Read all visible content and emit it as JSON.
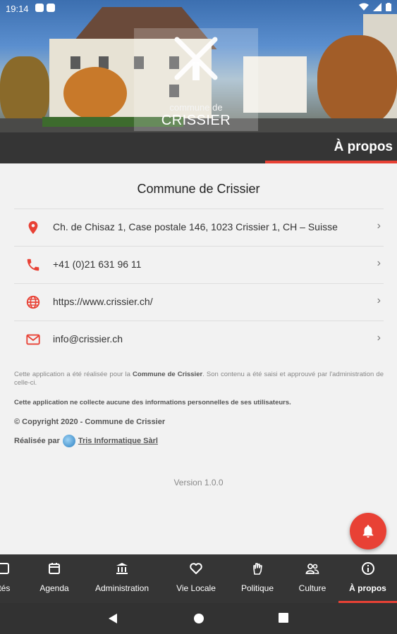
{
  "status_bar": {
    "time": "19:14",
    "battery": "◢"
  },
  "hero": {
    "logo_subtitle": "commune de",
    "logo_title": "CRISSIER"
  },
  "header": {
    "title": "À propos"
  },
  "content": {
    "heading": "Commune de Crissier",
    "contacts": [
      {
        "icon": "location-pin-icon",
        "text": "Ch. de Chisaz 1, Case postale 146, 1023 Crissier 1, CH – Suisse"
      },
      {
        "icon": "phone-icon",
        "text": "+41 (0)21 631 96 11"
      },
      {
        "icon": "globe-icon",
        "text": "https://www.crissier.ch/"
      },
      {
        "icon": "mail-icon",
        "text": "info@crissier.ch"
      }
    ],
    "note1_before": "Cette application a été réalisée pour la ",
    "note1_bold": "Commune de Crissier",
    "note1_after": ". Son contenu a été saisi et approuvé par l'administration de celle-ci.",
    "note2": "Cette application ne collecte aucune des informations personnelles de ses utilisateurs.",
    "copyright": "© Copyright 2020 - Commune de Crissier",
    "made_by_label": "Réalisée par",
    "made_by_link": "Tris Informatique Sàrl",
    "version": "Version 1.0.0"
  },
  "bottom_nav": [
    {
      "label": "ités",
      "icon": "news-icon"
    },
    {
      "label": "Agenda",
      "icon": "calendar-icon"
    },
    {
      "label": "Administration",
      "icon": "building-icon"
    },
    {
      "label": "Vie Locale",
      "icon": "heart-icon"
    },
    {
      "label": "Politique",
      "icon": "hand-icon"
    },
    {
      "label": "Culture",
      "icon": "people-icon"
    },
    {
      "label": "À propos",
      "icon": "info-icon"
    }
  ],
  "colors": {
    "accent": "#e84135",
    "bar": "#353535",
    "background": "#f2f2f2"
  }
}
